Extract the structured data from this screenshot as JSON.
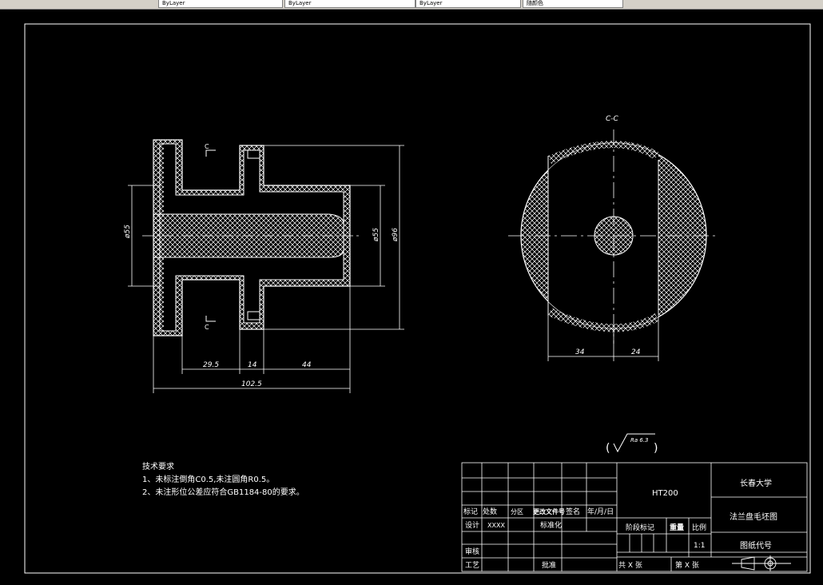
{
  "toolbar": {
    "tabs": [
      "ByLayer",
      "ByLayer",
      "ByLayer",
      "随颜色"
    ]
  },
  "drawing": {
    "section_label_left_top": "C",
    "section_label_left_bottom": "C",
    "section_view_title": "C-C",
    "dims_left": {
      "d_left": "ø55",
      "d_inner": "ø55",
      "d_outer": "ø96",
      "len_a": "29.5",
      "len_b": "14",
      "len_c": "44",
      "len_total": "102.5"
    },
    "dims_right": {
      "left": "34",
      "right": "24"
    },
    "roughness": "Ra 6.3"
  },
  "notes": {
    "title": "技术要求",
    "line1": "1、未标注倒角C0.5,未注圆角R0.5。",
    "line2": "2、未注形位公差应符合GB1184-80的要求。"
  },
  "title_block": {
    "material": "HT200",
    "school": "长春大学",
    "part_name": "法兰盘毛坯图",
    "drawing_code_label": "图纸代号",
    "row_mark": [
      "标记",
      "处数",
      "分区",
      "更改文件号",
      "签名",
      "年/月/日"
    ],
    "design_label": "设计",
    "design_value": "XXXX",
    "standardize_label": "标准化",
    "review_label": "审核",
    "process_label": "工艺",
    "approve_label": "批准",
    "stage_mark_label": "阶段标记",
    "weight_label": "重量",
    "scale_label": "比例",
    "scale_value": "1:1",
    "sheets_total": "共  X  张",
    "sheet_no": "第  X  张"
  }
}
